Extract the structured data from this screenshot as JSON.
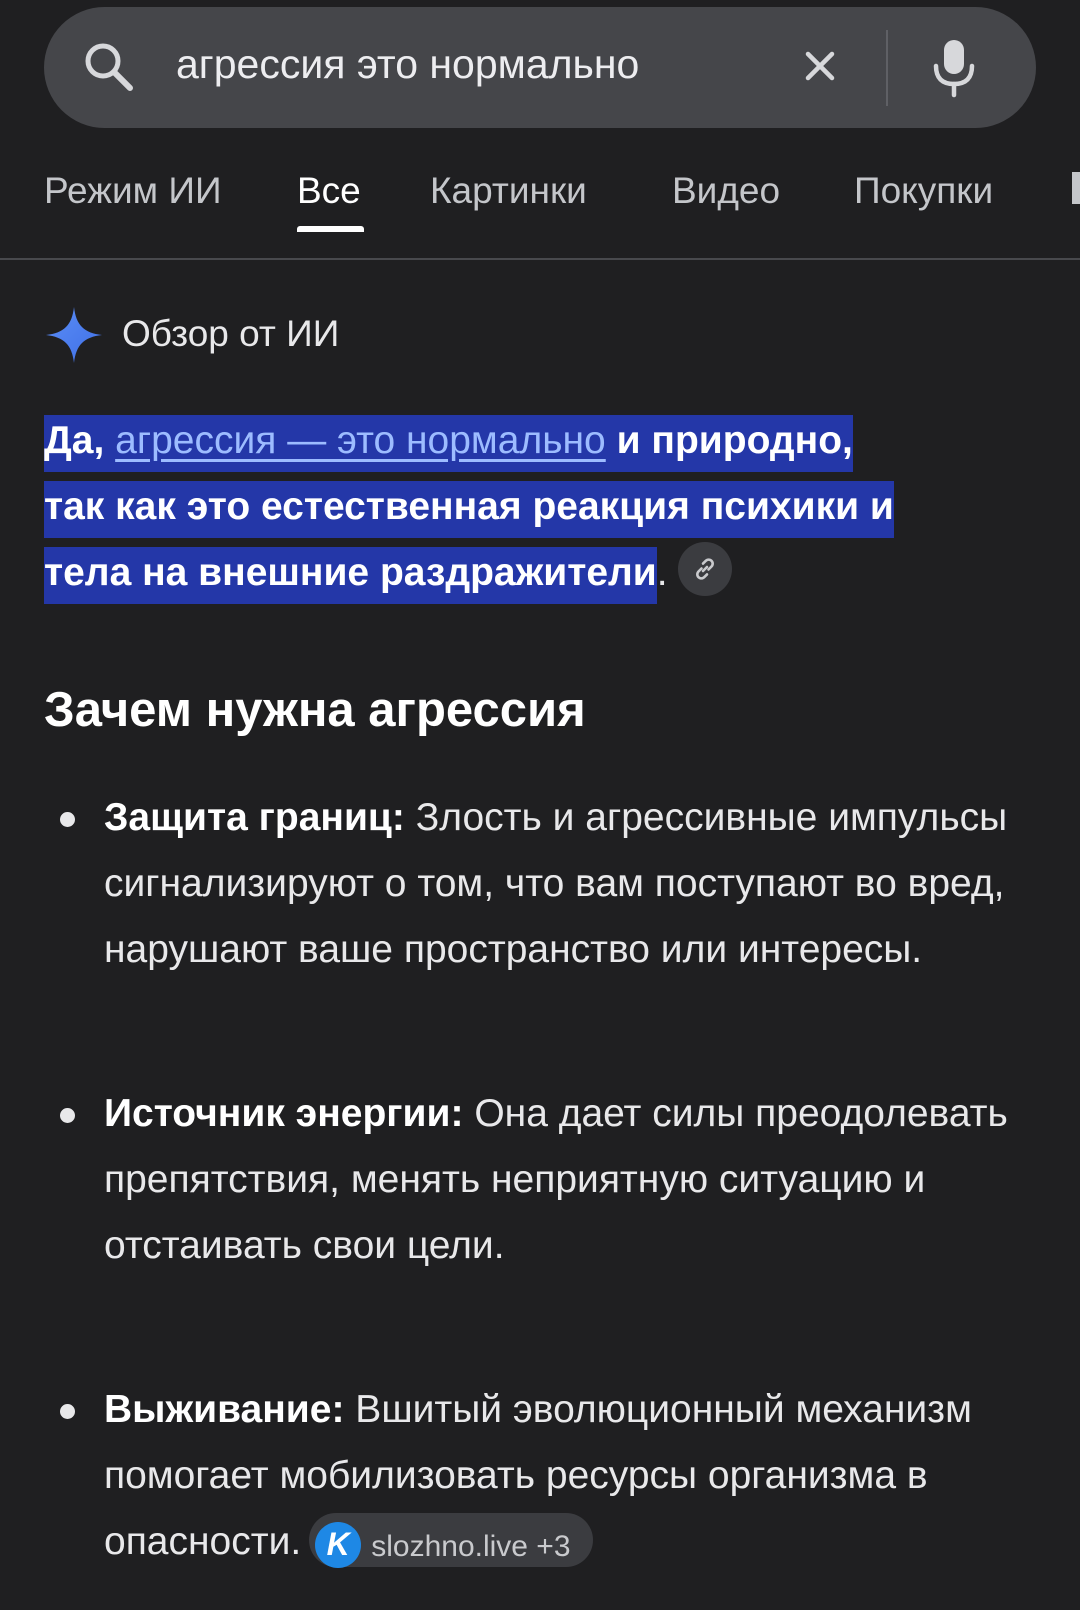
{
  "search": {
    "query": "агрессия это нормально"
  },
  "tabs": [
    {
      "label": "Режим ИИ"
    },
    {
      "label": "Все"
    },
    {
      "label": "Картинки"
    },
    {
      "label": "Видео"
    },
    {
      "label": "Покупки"
    }
  ],
  "active_tab": "Все",
  "ai_overview": {
    "title": "Обзор от ИИ",
    "summary_prefix": "Да, ",
    "summary_link": "агрессия — это нормально",
    "summary_line1_end": " и природно,",
    "summary_line2": "так как это естественная реакция психики и",
    "summary_line3": "тела на внешние раздражители",
    "summary_period": "."
  },
  "section": {
    "heading": "Зачем нужна агрессия"
  },
  "bullets": [
    {
      "term": "Защита границ:",
      "text": " Злость и агрессивные импульсы сигнализируют о том, что вам поступают во вред, нарушают ваше пространство или интересы."
    },
    {
      "term": "Источник энергии:",
      "text": " Она дает силы преодолевать препятствия, менять неприятную ситуацию и отстаивать свои цели."
    },
    {
      "term": "Выживание:",
      "text": " Вшитый эволюционный механизм помогает мобилизовать ресурсы организма в опасности."
    }
  ],
  "source_chip": {
    "logo_letter": "K",
    "label": "slozhno.live +3"
  },
  "colors": {
    "background": "#1f1f21",
    "search_bar": "#45464a",
    "highlight": "#2437a8",
    "link": "#9dbcff",
    "sparkle": "#4f8df6"
  }
}
